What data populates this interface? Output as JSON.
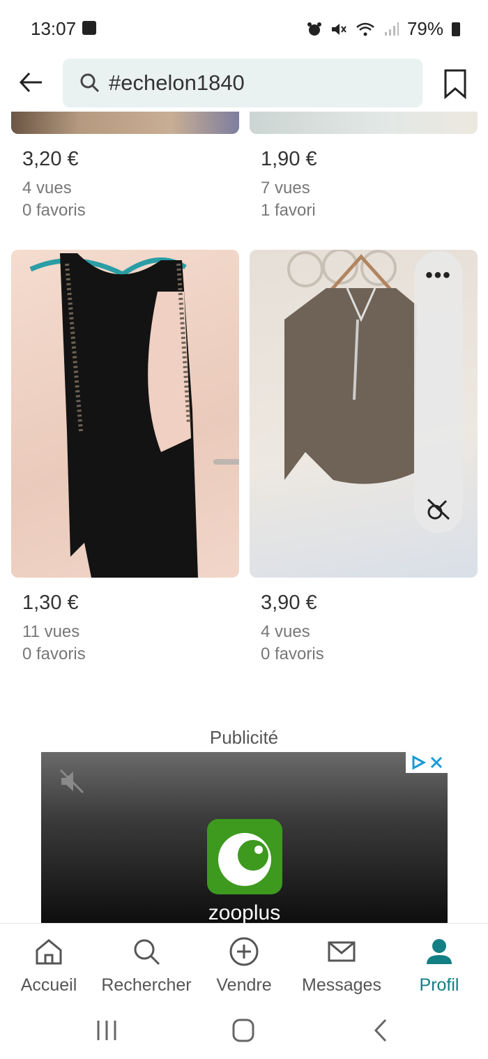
{
  "status_bar": {
    "time": "13:07",
    "battery": "79%",
    "icons": [
      "image-icon",
      "alarm-icon",
      "mute-icon",
      "wifi-icon",
      "signal-icon",
      "battery-icon"
    ]
  },
  "search": {
    "value": "#echelon1840"
  },
  "listings_top": [
    {
      "price": "3,20 €",
      "views": "4 vues",
      "favorites": "0 favoris"
    },
    {
      "price": "1,90 €",
      "views": "7 vues",
      "favorites": "1 favori"
    }
  ],
  "listings_bottom": [
    {
      "price": "1,30 €",
      "views": "11 vues",
      "favorites": "0 favoris"
    },
    {
      "price": "3,90 €",
      "views": "4 vues",
      "favorites": "0 favoris"
    }
  ],
  "overlay": {
    "more": "•••"
  },
  "ad": {
    "label": "Publicité",
    "brand": "zooplus",
    "brand_color": "#3d9a1f"
  },
  "nav": {
    "items": [
      {
        "label": "Accueil",
        "icon": "home-icon"
      },
      {
        "label": "Rechercher",
        "icon": "search-icon"
      },
      {
        "label": "Vendre",
        "icon": "plus-circle-icon"
      },
      {
        "label": "Messages",
        "icon": "mail-icon"
      },
      {
        "label": "Profil",
        "icon": "profile-icon"
      }
    ],
    "active_color": "#137f84"
  }
}
